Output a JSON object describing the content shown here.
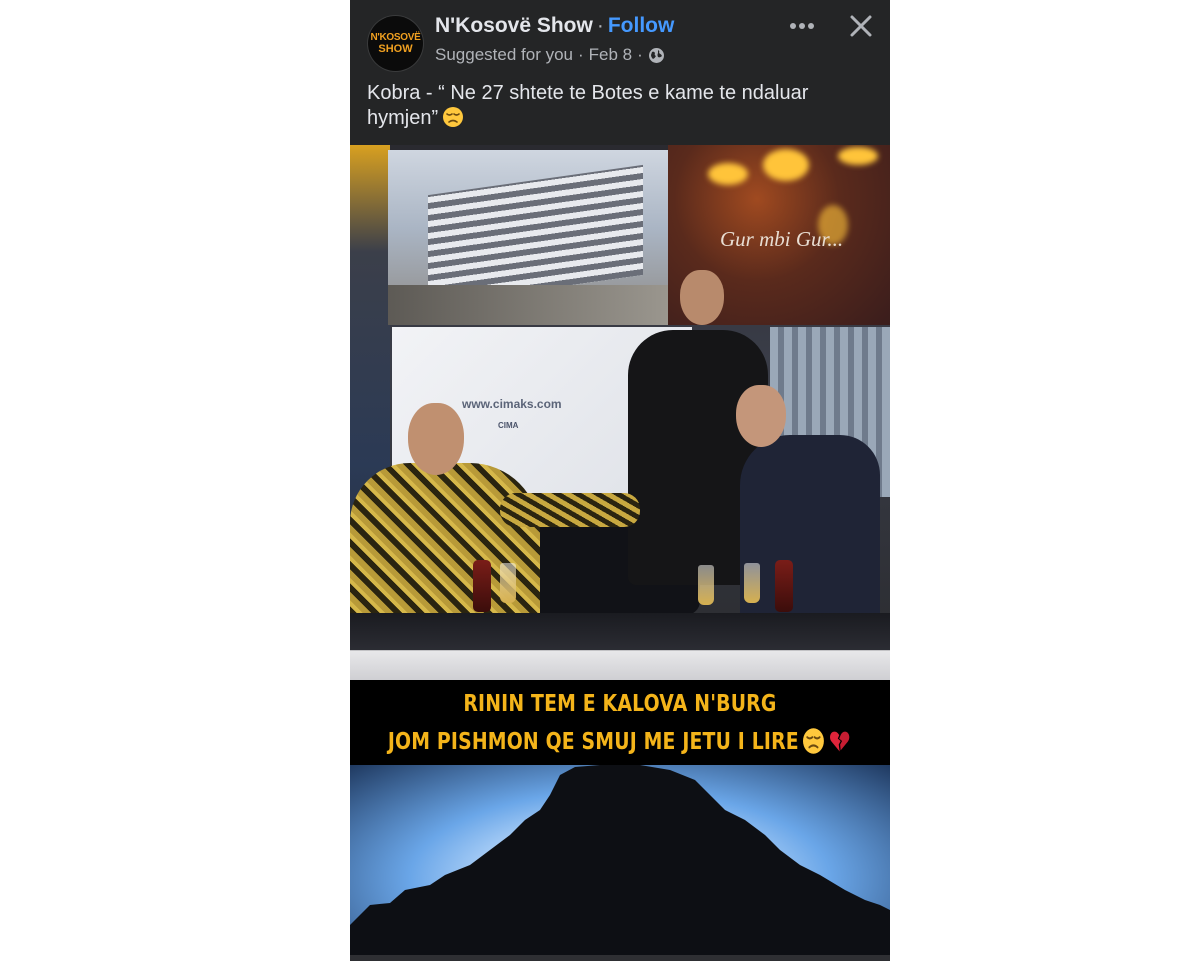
{
  "post": {
    "avatar": {
      "line1": "N'KOSOVË",
      "line2": "SHOW",
      "accent": "#f0a020"
    },
    "page_name": "N'Kosovë Show",
    "name_separator": "·",
    "follow_label": "Follow",
    "meta": {
      "suggestion": "Suggested for you",
      "date": "Feb 8",
      "separator": "·",
      "audience_icon": "globe-icon"
    },
    "header_icons": [
      "more-icon",
      "close-icon"
    ],
    "caption": "Kobra - “ Ne 27 shtete te Botes e kame te ndaluar hymjen”",
    "caption_emoji": "disappointed-face-emoji"
  },
  "video": {
    "banner_text": "Gur mbi Gur...",
    "wall_url": "www.cimaks.com",
    "wall_brand": "CIMA",
    "subtitle_line1": "RININ TEM E KALOVA N'BURG",
    "subtitle_line2": "JOM PISHMON QE SMUJ ME JETU I LIRE",
    "subtitle_emojis": [
      "disappointed-face-emoji",
      "broken-heart-emoji"
    ]
  },
  "colors": {
    "card_bg": "#242526",
    "link_blue": "#4599ff",
    "subtitle_gold": "#f4b41a"
  }
}
